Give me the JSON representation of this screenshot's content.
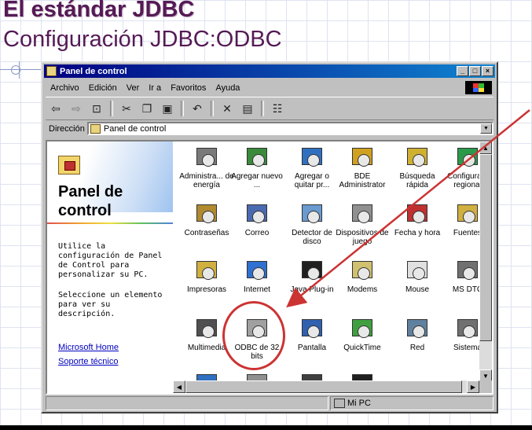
{
  "slide": {
    "title": "El estándar JDBC",
    "subtitle": "Configuración JDBC:ODBC"
  },
  "window": {
    "title": "Panel de control",
    "title_buttons": [
      "_",
      "□",
      "×"
    ],
    "menu": [
      "Archivo",
      "Edición",
      "Ver",
      "Ir a",
      "Favoritos",
      "Ayuda"
    ],
    "address_label": "Dirección",
    "address_value": "Panel de control"
  },
  "toolbar": {
    "icons": [
      "back-icon",
      "forward-icon",
      "up-folder-icon",
      "cut-icon",
      "copy-icon",
      "paste-icon",
      "undo-icon",
      "delete-icon",
      "properties-icon",
      "views-icon"
    ]
  },
  "left_panel": {
    "title": "Panel de control",
    "description": "Utilice la configuración de Panel de Control para personalizar su PC.",
    "hint": "Seleccione un elemento para ver su descripción.",
    "links": [
      "Microsoft Home",
      "Soporte técnico"
    ]
  },
  "icons": [
    {
      "label": "Administra... de energía",
      "color": "#7a7a7a"
    },
    {
      "label": "Agregar nuevo ...",
      "color": "#3a8a3a"
    },
    {
      "label": "Agregar o quitar pr...",
      "color": "#3070c0"
    },
    {
      "label": "BDE Administrator",
      "color": "#d0a020"
    },
    {
      "label": "Búsqueda rápida",
      "color": "#d0b030"
    },
    {
      "label": "Configura... regional",
      "color": "#2a9a4a"
    },
    {
      "label": "Contraseñas",
      "color": "#b08a30"
    },
    {
      "label": "Correo",
      "color": "#4a6ab0"
    },
    {
      "label": "Detector de disco",
      "color": "#6a9ad0"
    },
    {
      "label": "Dispositivos de juego",
      "color": "#909090"
    },
    {
      "label": "Fecha y hora",
      "color": "#c03030"
    },
    {
      "label": "Fuentes",
      "color": "#d0b040"
    },
    {
      "label": "Impresoras",
      "color": "#d0b040"
    },
    {
      "label": "Internet",
      "color": "#3070d0"
    },
    {
      "label": "Java Plug-in",
      "color": "#202020"
    },
    {
      "label": "Modems",
      "color": "#d0c070"
    },
    {
      "label": "Mouse",
      "color": "#e0e0e0"
    },
    {
      "label": "MS DTC",
      "color": "#707070"
    },
    {
      "label": "Multimedia",
      "color": "#505050"
    },
    {
      "label": "ODBC de 32 bits",
      "color": "#a0a0a0"
    },
    {
      "label": "Pantalla",
      "color": "#3060b0"
    },
    {
      "label": "QuickTime",
      "color": "#40a040"
    },
    {
      "label": "Red",
      "color": "#6080a0"
    },
    {
      "label": "Sistema",
      "color": "#707070"
    },
    {
      "label": "",
      "color": "#3070c0"
    },
    {
      "label": "",
      "color": "#909090"
    },
    {
      "label": "",
      "color": "#404040"
    },
    {
      "label": "",
      "color": "#202020"
    }
  ],
  "status": {
    "location": "Mi PC"
  }
}
